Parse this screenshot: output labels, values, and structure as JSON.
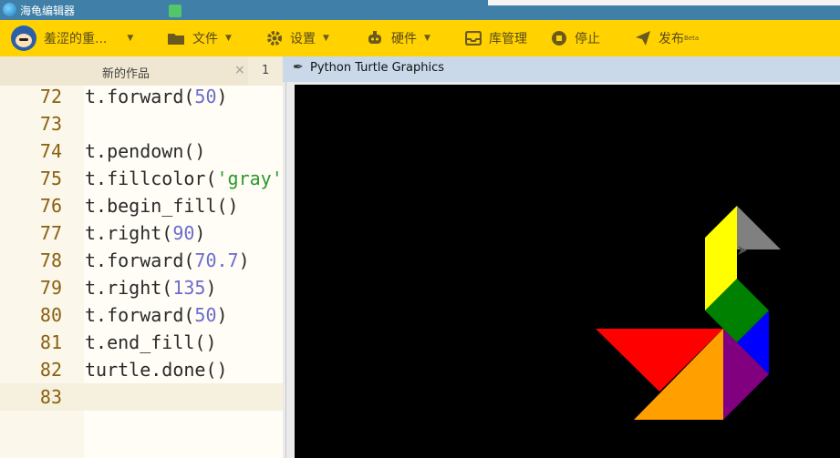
{
  "window": {
    "title": "海龟编辑器"
  },
  "toolbar": {
    "user_name": "羞涩的重...",
    "file": "文件",
    "settings": "设置",
    "hardware": "硬件",
    "library": "库管理",
    "stop": "停止",
    "publish": "发布",
    "publish_badge": "Beta"
  },
  "editor": {
    "tab_label": "新的作品",
    "tab_close": "×",
    "tab_number": "1",
    "lines": [
      {
        "n": "72",
        "parts": [
          [
            "t.forward(",
            ""
          ],
          [
            "50",
            "num"
          ],
          [
            ")",
            ""
          ]
        ]
      },
      {
        "n": "73",
        "parts": []
      },
      {
        "n": "74",
        "parts": [
          [
            "t.pendown()",
            ""
          ]
        ]
      },
      {
        "n": "75",
        "parts": [
          [
            "t.fillcolor(",
            ""
          ],
          [
            "'gray'",
            "str"
          ]
        ]
      },
      {
        "n": "76",
        "parts": [
          [
            "t.begin_fill()",
            ""
          ]
        ]
      },
      {
        "n": "77",
        "parts": [
          [
            "t.right(",
            ""
          ],
          [
            "90",
            "num"
          ],
          [
            ")",
            ""
          ]
        ]
      },
      {
        "n": "78",
        "parts": [
          [
            "t.forward(",
            ""
          ],
          [
            "70.7",
            "num"
          ],
          [
            ")",
            ""
          ]
        ]
      },
      {
        "n": "79",
        "parts": [
          [
            "t.right(",
            ""
          ],
          [
            "135",
            "num"
          ],
          [
            ")",
            ""
          ]
        ]
      },
      {
        "n": "80",
        "parts": [
          [
            "t.forward(",
            ""
          ],
          [
            "50",
            "num"
          ],
          [
            ")",
            ""
          ]
        ]
      },
      {
        "n": "81",
        "parts": [
          [
            "t.end_fill()",
            ""
          ]
        ]
      },
      {
        "n": "82",
        "parts": [
          [
            "turtle.done()",
            ""
          ]
        ]
      },
      {
        "n": "83",
        "parts": []
      }
    ]
  },
  "turtle_window": {
    "title": "Python Turtle Graphics",
    "background": "#000000",
    "pieces": [
      {
        "name": "red-triangle",
        "color": "#ff0000"
      },
      {
        "name": "orange-triangle",
        "color": "#ffa000"
      },
      {
        "name": "purple-triangle",
        "color": "#800080"
      },
      {
        "name": "blue-triangle",
        "color": "#0000ff"
      },
      {
        "name": "green-square",
        "color": "#008000"
      },
      {
        "name": "yellow-parallelogram",
        "color": "#ffff00"
      },
      {
        "name": "gray-triangle",
        "color": "#808080"
      }
    ]
  },
  "colors": {
    "toolbar": "#ffd200",
    "titlebar": "#3f7fa8"
  }
}
